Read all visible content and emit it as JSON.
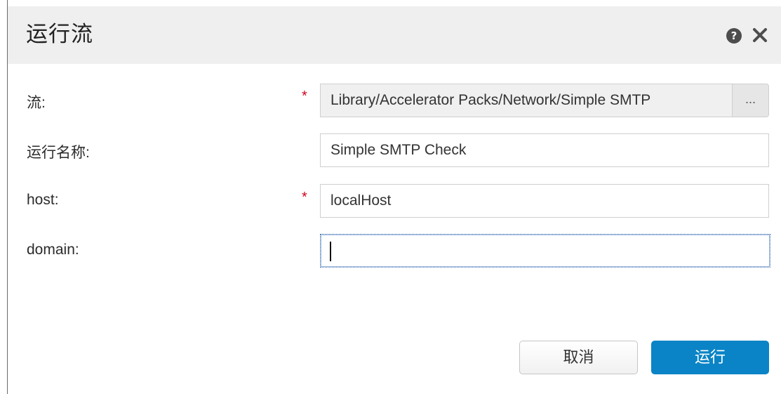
{
  "dialog": {
    "title": "运行流",
    "help_icon": "help-icon",
    "close_icon": "close-icon",
    "help_glyph": "?"
  },
  "form": {
    "flow": {
      "label": "流:",
      "required": "*",
      "value": "Library/Accelerator Packs/Network/Simple SMTP",
      "browse_label": "..."
    },
    "run_name": {
      "label": "运行名称:",
      "value": "Simple SMTP Check"
    },
    "host": {
      "label": "host:",
      "required": "*",
      "value": "localHost"
    },
    "domain": {
      "label": "domain:",
      "value": ""
    }
  },
  "buttons": {
    "cancel_label": "取消",
    "run_label": "运行"
  },
  "colors": {
    "accent": "#0a84c6",
    "required": "#d0021b",
    "titlebar": "#efefef"
  }
}
